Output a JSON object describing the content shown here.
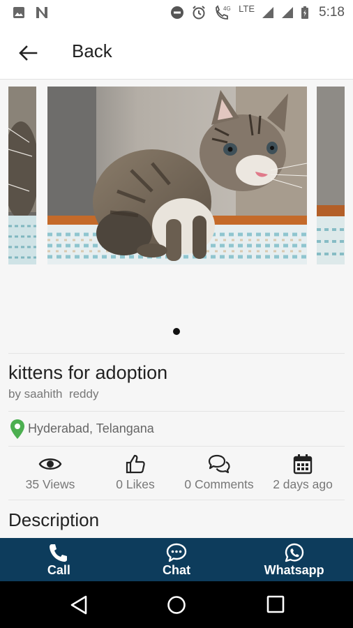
{
  "status_bar": {
    "time": "5:18",
    "network": "LTE",
    "call_tag": "4G",
    "icons": [
      "image-icon",
      "n-icon",
      "dnd-icon",
      "alarm-icon",
      "wifi-call-icon",
      "signal-icon",
      "signal-icon",
      "battery-icon"
    ]
  },
  "app_bar": {
    "back_label": "Back",
    "back_icon": "arrow-left-icon"
  },
  "carousel": {
    "slides": 3,
    "active_index": 0,
    "indicator_count": 1
  },
  "listing": {
    "title": "kittens for adoption",
    "author": "by saahith  reddy",
    "location": "Hyderabad, Telangana"
  },
  "stats": {
    "views": "35 Views",
    "likes": "0 Likes",
    "comments": "0 Comments",
    "posted": "2 days ago"
  },
  "description": {
    "heading": "Description"
  },
  "actions": {
    "call": "Call",
    "chat": "Chat",
    "whatsapp": "Whatsapp"
  },
  "colors": {
    "action_bar": "#0d3c5c",
    "location_pin": "#4caf50",
    "background": "#f6f6f6"
  }
}
